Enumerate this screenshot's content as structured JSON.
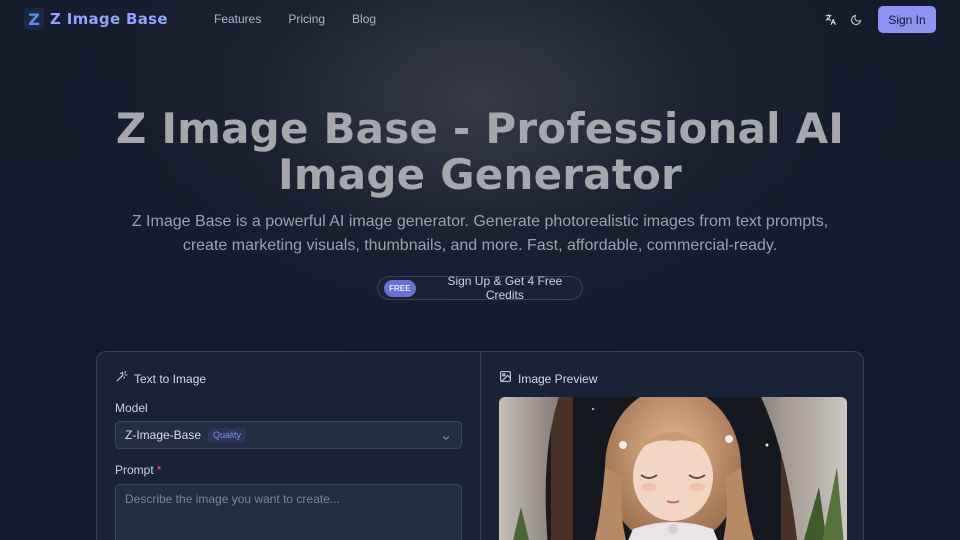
{
  "header": {
    "logo_mark": "Z",
    "logo_text": "Z Image Base",
    "nav": [
      "Features",
      "Pricing",
      "Blog"
    ],
    "translate_icon": "translate-icon",
    "theme_icon": "moon-icon",
    "signin_label": "Sign In"
  },
  "hero": {
    "title_line1": "Z Image Base - Professional AI",
    "title_line2": "Image Generator",
    "subtitle": "Z Image Base is a powerful AI image generator. Generate photorealistic images from text prompts, create marketing visuals, thumbnails, and more. Fast, affordable, commercial-ready.",
    "free_tag": "FREE",
    "cta_text": "Sign Up & Get 4 Free Credits"
  },
  "generator": {
    "title": "Text to Image",
    "title_icon": "magic-wand-icon",
    "model_label": "Model",
    "model_value": "Z-Image-Base",
    "model_badge": "Quality",
    "prompt_label": "Prompt",
    "prompt_required": "*",
    "prompt_placeholder": "Describe the image you want to create...",
    "prompt_value": ""
  },
  "preview": {
    "title": "Image Preview",
    "title_icon": "image-icon"
  },
  "colors": {
    "background": "#111a2d",
    "accent": "#8c93f2",
    "logo": "#8fa3ff",
    "panel": "#1a2336"
  }
}
